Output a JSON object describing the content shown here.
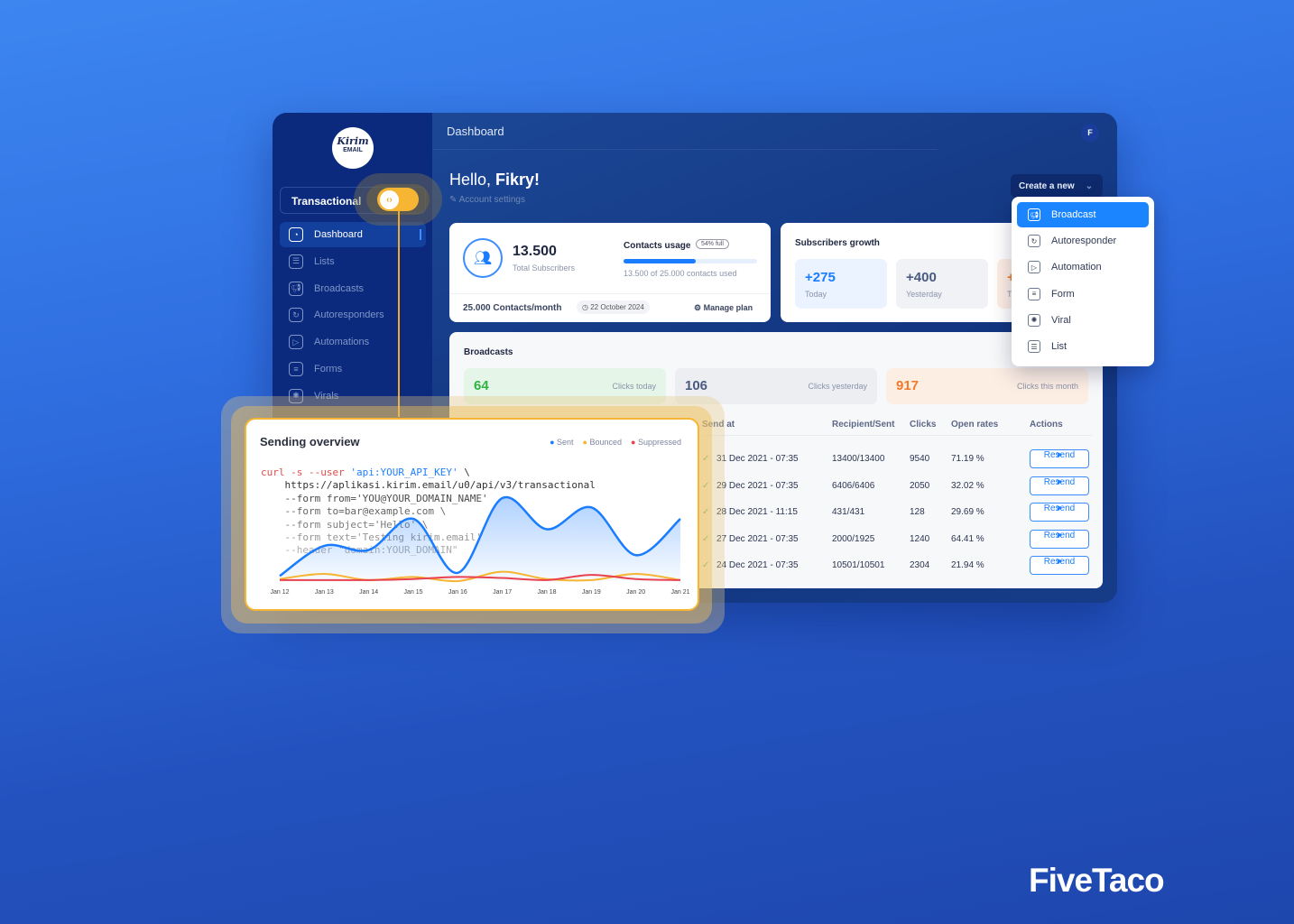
{
  "brand": {
    "logo_text": "Kirim",
    "logo_sub": "EMAIL",
    "watermark": "FiveTaco"
  },
  "sidebar": {
    "mode_label": "Transactional",
    "toggle_icon": "code-icon",
    "items": [
      {
        "label": "Dashboard",
        "icon": "dashboard-icon",
        "active": true
      },
      {
        "label": "Lists",
        "icon": "list-icon"
      },
      {
        "label": "Broadcasts",
        "icon": "megaphone-icon"
      },
      {
        "label": "Autoresponders",
        "icon": "autoresponder-icon"
      },
      {
        "label": "Automations",
        "icon": "automation-icon"
      },
      {
        "label": "Forms",
        "icon": "form-icon"
      },
      {
        "label": "Virals",
        "icon": "viral-icon"
      }
    ]
  },
  "header": {
    "title": "Dashboard",
    "avatar": "F",
    "greeting": "Hello, ",
    "name": "Fikry!",
    "account_settings": "Account settings",
    "create_label": "Create a new"
  },
  "create_menu": [
    {
      "label": "Broadcast",
      "icon": "megaphone-icon",
      "active": true
    },
    {
      "label": "Autoresponder",
      "icon": "autoresponder-icon"
    },
    {
      "label": "Automation",
      "icon": "automation-icon"
    },
    {
      "label": "Form",
      "icon": "form-icon"
    },
    {
      "label": "Viral",
      "icon": "viral-icon"
    },
    {
      "label": "List",
      "icon": "list-icon"
    }
  ],
  "subscribers": {
    "total": "13.500",
    "total_label": "Total Subscribers",
    "usage_title": "Contacts usage",
    "usage_badge": "54% full",
    "usage_fraction": 0.54,
    "usage_text": "13.500 of 25.000 contacts used",
    "plan": "25.000 Contacts/month",
    "date": "22 October 2024",
    "manage": "Manage plan"
  },
  "growth": {
    "title": "Subscribers growth",
    "cards": [
      {
        "value": "+275",
        "label": "Today"
      },
      {
        "value": "+400",
        "label": "Yesterday"
      },
      {
        "value": "+",
        "label": "T"
      }
    ]
  },
  "broadcasts": {
    "title": "Broadcasts",
    "stats": [
      {
        "value": "64",
        "label": "Clicks today",
        "color": "#2fb344"
      },
      {
        "value": "106",
        "label": "Clicks yesterday",
        "color": "#4a5a80"
      },
      {
        "value": "917",
        "label": "Clicks this month",
        "color": "#f07a2a"
      }
    ],
    "columns": [
      "Send at",
      "Recipient/Sent",
      "Clicks",
      "Open rates",
      "Actions"
    ],
    "rows": [
      {
        "sent_at": "31 Dec 2021 - 07:35",
        "recipients": "13400/13400",
        "clicks": "9540",
        "open": "71.19 %",
        "action": "Resend"
      },
      {
        "sent_at": "29 Dec 2021 - 07:35",
        "recipients": "6406/6406",
        "clicks": "2050",
        "open": "32.02 %",
        "action": "Resend"
      },
      {
        "sent_at": "28 Dec 2021 - 11:15",
        "recipients": "431/431",
        "clicks": "128",
        "open": "29.69 %",
        "action": "Resend"
      },
      {
        "sent_at": "27 Dec 2021 - 07:35",
        "recipients": "2000/1925",
        "clicks": "1240",
        "open": "64.41 %",
        "action": "Resend"
      },
      {
        "sent_at": "24 Dec 2021 - 07:35",
        "recipients": "10501/10501",
        "clicks": "2304",
        "open": "21.94 %",
        "action": "Resend"
      }
    ]
  },
  "overview": {
    "title": "Sending overview",
    "code": [
      "curl -s --user 'api:YOUR_API_KEY' \\",
      "    https://aplikasi.kirim.email/u0/api/v3/transactional",
      "    --form from='YOU@YOUR_DOMAIN_NAME'",
      "    --form to=bar@example.com \\",
      "    --form subject='Hello' \\",
      "    --form text='Testing kirim.email'",
      "    --header \"domain:YOUR_DOMAIN\""
    ]
  },
  "chart_data": {
    "type": "area",
    "categories": [
      "Jan 12",
      "Jan 13",
      "Jan 14",
      "Jan 15",
      "Jan 16",
      "Jan 17",
      "Jan 18",
      "Jan 19",
      "Jan 20",
      "Jan 21"
    ],
    "legend_position": "top-right",
    "grid": false,
    "series": [
      {
        "name": "Sent",
        "color": "#1a7cff",
        "values": [
          5,
          34,
          30,
          60,
          8,
          80,
          50,
          71,
          25,
          60
        ]
      },
      {
        "name": "Bounced",
        "color": "#f6b532",
        "values": [
          2,
          7,
          1,
          4,
          0,
          9,
          2,
          1,
          7,
          1
        ]
      },
      {
        "name": "Suppressed",
        "color": "#e8424f",
        "values": [
          1,
          1,
          1,
          2,
          4,
          3,
          1,
          6,
          2,
          1
        ]
      }
    ]
  }
}
